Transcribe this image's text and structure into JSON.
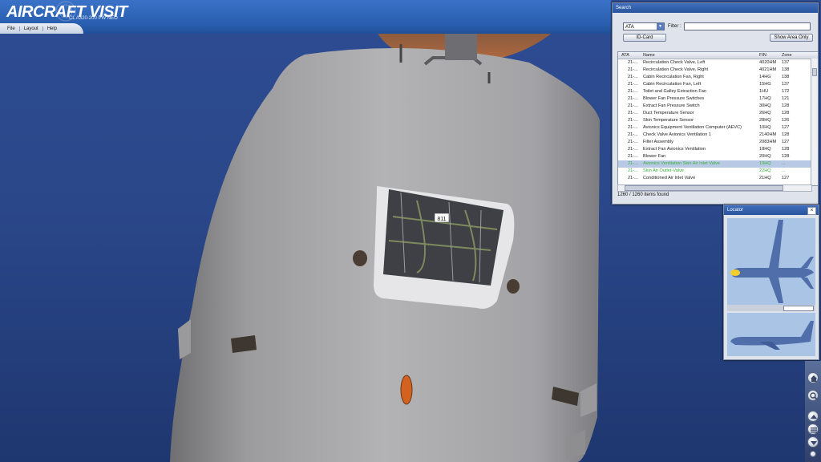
{
  "app": {
    "brand_title": "AIRCRAFT VISIT",
    "aircraft_model": "CL A320-200 PW NEO",
    "menu": [
      "File",
      "Layout",
      "Help"
    ]
  },
  "scene": {
    "panel_tag": "811",
    "sky_color": "#2b4888",
    "fuselage_color": "#a2a2a4"
  },
  "search_panel": {
    "title": "Search",
    "category_select": "ATA",
    "filter_label": "Filter :",
    "filter_value": "",
    "id_card_button": "ID-Card",
    "show_area_button": "Show Area Only",
    "columns": {
      "ata": "ATA",
      "name": "Name",
      "fin": "FIN",
      "zone": "Zone"
    },
    "rows": [
      {
        "ata": "21-...",
        "name": "Recirculation Check Valve, Left",
        "fin": "4020HM",
        "zone": "137"
      },
      {
        "ata": "21-...",
        "name": "Recirculation Check Valve, Right",
        "fin": "4021HM",
        "zone": "138"
      },
      {
        "ata": "21-...",
        "name": "Cabin Recirculation Fan, Right",
        "fin": "14HG",
        "zone": "138"
      },
      {
        "ata": "21-...",
        "name": "Cabin Recirculation Fan, Left",
        "fin": "15HG",
        "zone": "137"
      },
      {
        "ata": "21-...",
        "name": "Toilet and Galley Extraction Fan",
        "fin": "1HU",
        "zone": "172"
      },
      {
        "ata": "21-...",
        "name": "Blower Fan Pressure Switches",
        "fin": "17HQ",
        "zone": "121"
      },
      {
        "ata": "21-...",
        "name": "Extract Fan Pressure Switch",
        "fin": "30HQ",
        "zone": "128"
      },
      {
        "ata": "21-...",
        "name": "Duct Temperature Sensor",
        "fin": "26HQ",
        "zone": "128"
      },
      {
        "ata": "21-...",
        "name": "Skin Temperature Sensor",
        "fin": "28HQ",
        "zone": "126"
      },
      {
        "ata": "21-...",
        "name": "Avionics Equipment Ventilation Computer (AEVC)",
        "fin": "10HQ",
        "zone": "127"
      },
      {
        "ata": "21-...",
        "name": "Check Valve Avionics Ventilation 1",
        "fin": "2140HM",
        "zone": "128"
      },
      {
        "ata": "21-...",
        "name": "Filter Assembly",
        "fin": "2083HM",
        "zone": "127"
      },
      {
        "ata": "21-...",
        "name": "Extract Fan Avionics Ventilation",
        "fin": "18HQ",
        "zone": "128"
      },
      {
        "ata": "21-...",
        "name": "Blower Fan",
        "fin": "20HQ",
        "zone": "128"
      },
      {
        "ata": "21-...",
        "name": "Avionics Ventilation Skin Air Inlet Valve",
        "fin": "19HQ",
        "zone": "..."
      },
      {
        "ata": "21-...",
        "name": "Skin Air Outlet-Valve",
        "fin": "22HQ",
        "zone": "..."
      },
      {
        "ata": "21-...",
        "name": "Conditioned Air Inlet Valve",
        "fin": "21HQ",
        "zone": "127"
      }
    ],
    "selected_row": 14,
    "status": "1260 / 1260 items found"
  },
  "locator_panel": {
    "title": "Locator"
  },
  "nav_icons": [
    "home-icon",
    "zoom-icon",
    "scroll-up-icon",
    "menu-icon",
    "scroll-down-icon"
  ]
}
